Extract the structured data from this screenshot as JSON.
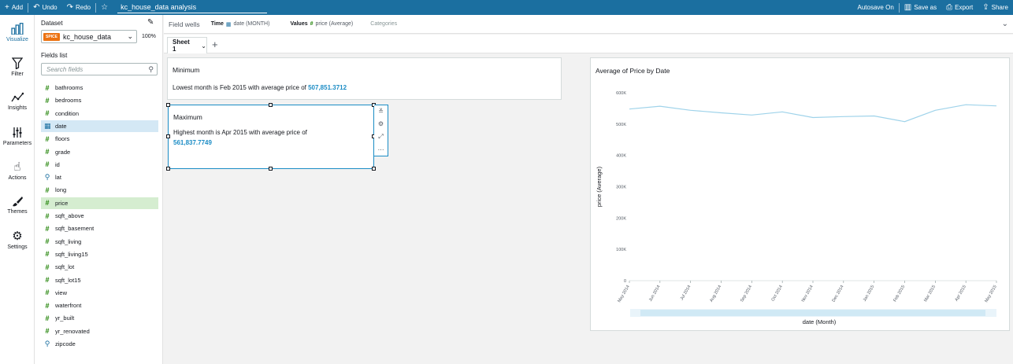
{
  "topbar": {
    "add": "Add",
    "undo": "Undo",
    "redo": "Redo",
    "analysis_title": "kc_house_data analysis",
    "autosave": "Autosave On",
    "save_as": "Save as",
    "export": "Export",
    "share": "Share"
  },
  "nav": {
    "visualize": "Visualize",
    "filter": "Filter",
    "insights": "Insights",
    "parameters": "Parameters",
    "actions": "Actions",
    "themes": "Themes",
    "settings": "Settings"
  },
  "dataset": {
    "label": "Dataset",
    "spice": "SPICE",
    "name": "kc_house_data",
    "percent": "100%"
  },
  "fields_list": {
    "label": "Fields list",
    "search_placeholder": "Search fields",
    "items": [
      {
        "name": "bathrooms",
        "icon": "hash"
      },
      {
        "name": "bedrooms",
        "icon": "hash"
      },
      {
        "name": "condition",
        "icon": "hash"
      },
      {
        "name": "date",
        "icon": "calendar"
      },
      {
        "name": "floors",
        "icon": "hash"
      },
      {
        "name": "grade",
        "icon": "hash"
      },
      {
        "name": "id",
        "icon": "hash"
      },
      {
        "name": "lat",
        "icon": "pin"
      },
      {
        "name": "long",
        "icon": "hash"
      },
      {
        "name": "price",
        "icon": "hash"
      },
      {
        "name": "sqft_above",
        "icon": "hash"
      },
      {
        "name": "sqft_basement",
        "icon": "hash"
      },
      {
        "name": "sqft_living",
        "icon": "hash"
      },
      {
        "name": "sqft_living15",
        "icon": "hash"
      },
      {
        "name": "sqft_lot",
        "icon": "hash"
      },
      {
        "name": "sqft_lot15",
        "icon": "hash"
      },
      {
        "name": "view",
        "icon": "hash"
      },
      {
        "name": "waterfront",
        "icon": "hash"
      },
      {
        "name": "yr_built",
        "icon": "hash"
      },
      {
        "name": "yr_renovated",
        "icon": "hash"
      },
      {
        "name": "zipcode",
        "icon": "pin"
      }
    ]
  },
  "wells": {
    "label": "Field wells",
    "time_label": "Time",
    "time_value": "date (MONTH)",
    "values_label": "Values",
    "values_value": "price (Average)",
    "categories_label": "Categories"
  },
  "sheet": {
    "tab_label": "Sheet 1"
  },
  "insights": {
    "minimum": {
      "title": "Minimum",
      "text": "Lowest month is Feb 2015 with average price of",
      "value": "507,851.3712"
    },
    "maximum": {
      "title": "Maximum",
      "text": "Highest month is Apr 2015 with average price of",
      "value": "561,837.7749"
    }
  },
  "chart_data": {
    "type": "line",
    "title": "Average of Price by Date",
    "xlabel": "date (Month)",
    "ylabel": "price (Average)",
    "categories": [
      "May 2014",
      "Jun 2014",
      "Jul 2014",
      "Aug 2014",
      "Sep 2014",
      "Oct 2014",
      "Nov 2014",
      "Dec 2014",
      "Jan 2015",
      "Feb 2015",
      "Mar 2015",
      "Apr 2015",
      "May 2015"
    ],
    "values": [
      548000,
      557000,
      544000,
      536000,
      529000,
      539000,
      521000,
      524000,
      526000,
      507851,
      544000,
      561838,
      558000
    ],
    "ylim": [
      0,
      600000
    ],
    "yticks": [
      0,
      100000,
      200000,
      300000,
      400000,
      500000,
      600000
    ],
    "ytick_labels": [
      "0",
      "100K",
      "200K",
      "300K",
      "400K",
      "500K",
      "600K"
    ],
    "line_color": "#9fd3ea",
    "grid": false
  }
}
